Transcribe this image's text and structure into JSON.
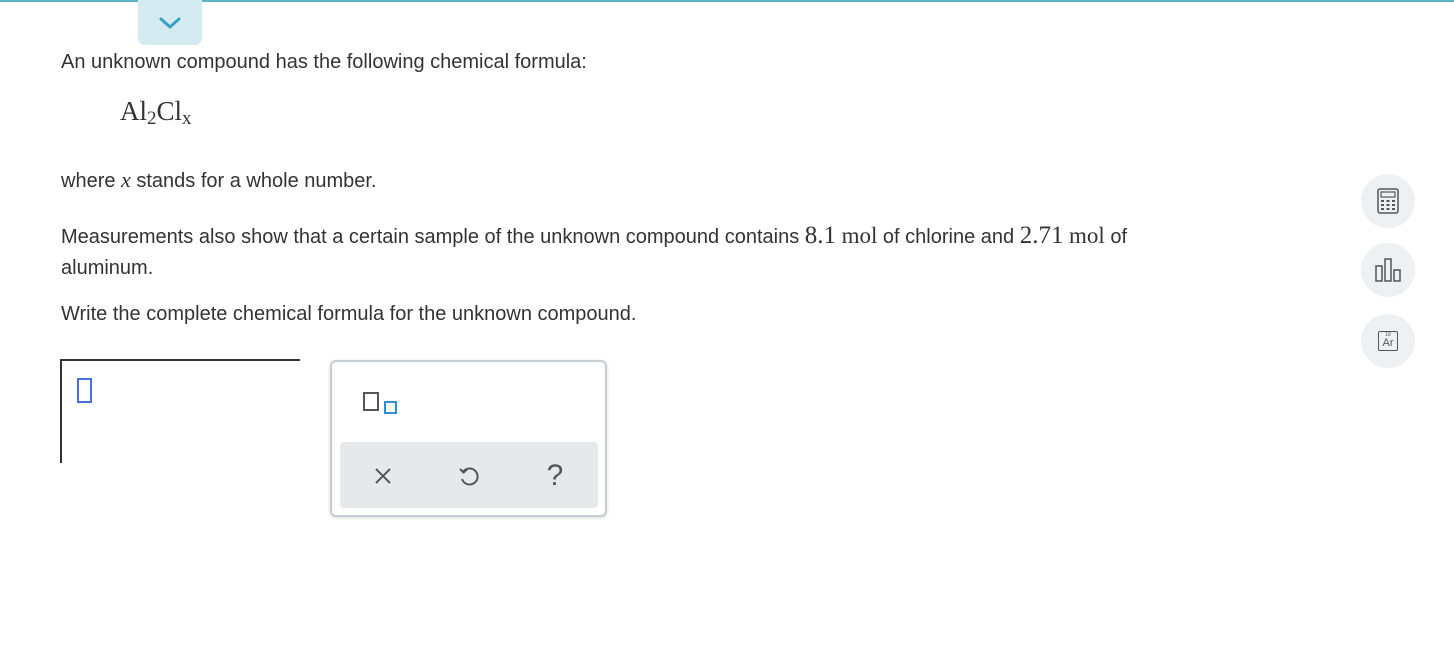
{
  "question": {
    "line1": "An unknown compound has the following chemical formula:",
    "formula": {
      "element1": "Al",
      "sub1": "2",
      "element2": "Cl",
      "sub2": "x"
    },
    "line2": {
      "pre": "where",
      "var": "x",
      "post": "stands for a whole number."
    },
    "line3": {
      "pre": "Measurements also show that a certain sample of the unknown compound contains",
      "value1": "8.1",
      "unit1": "mol",
      "mid": "of chlorine and",
      "value2": "2.71",
      "unit2": "mol",
      "post": "of",
      "wrap": "aluminum."
    },
    "line4": "Write the complete chemical formula for the unknown compound."
  },
  "palette": {
    "subscript_icon": "subscript-template-icon",
    "clear_icon": "x-icon",
    "undo_icon": "undo-icon",
    "help_label": "?"
  },
  "tools": {
    "calculator_icon": "calculator-icon",
    "data_icon": "bar-chart-icon",
    "periodic_table": {
      "number": "18",
      "symbol": "Ar"
    }
  },
  "colors": {
    "accent": "#5ab4c6",
    "tab_bg": "#d4ebf2",
    "caret": "#4a6edb",
    "subscript_blue": "#2f8fd6"
  }
}
